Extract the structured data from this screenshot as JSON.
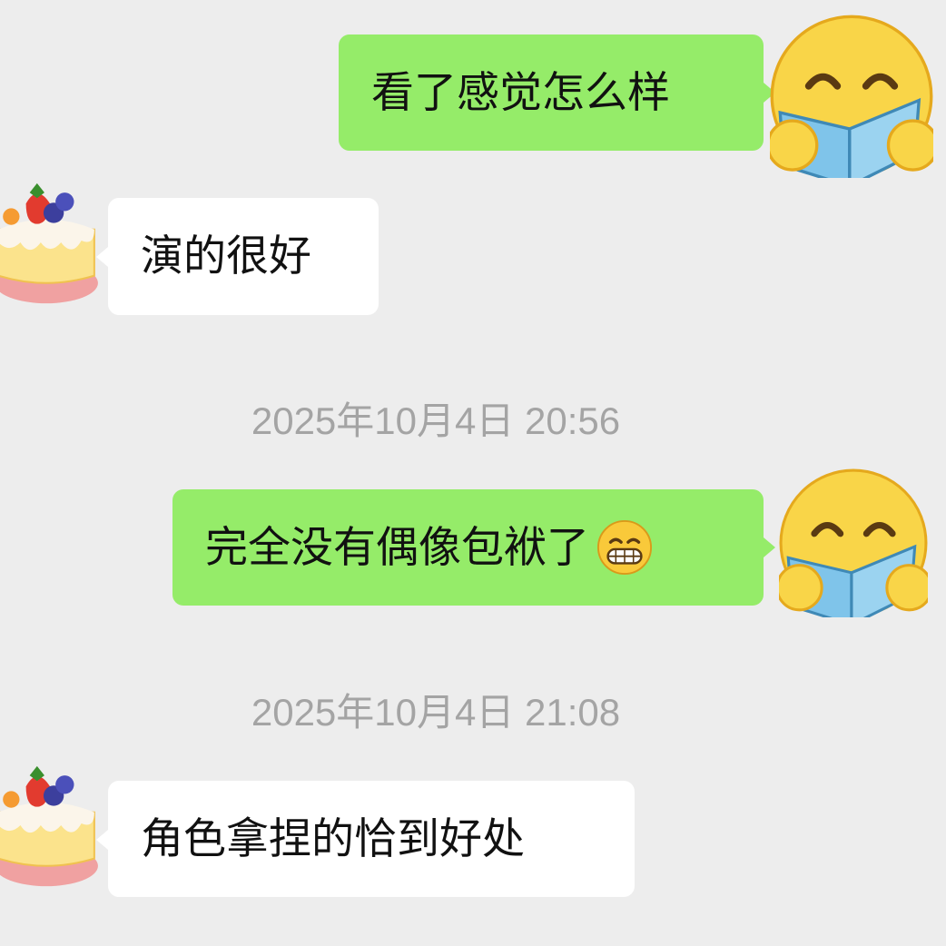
{
  "messages": [
    {
      "side": "sent",
      "text": "看了感觉怎么样"
    },
    {
      "side": "received",
      "text": "演的很好"
    },
    {
      "side": "sent",
      "text": "完全没有偶像包袱了",
      "emoji": "grinning-face-emoji"
    },
    {
      "side": "received",
      "text": "角色拿捏的恰到好处"
    }
  ],
  "timestamps": [
    "2025年10月4日 20:56",
    "2025年10月4日 21:08"
  ],
  "avatars": {
    "me": "reading-emoji-avatar",
    "contact": "cake-avatar"
  },
  "colors": {
    "background": "#ededed",
    "sent_bubble": "#95ec69",
    "received_bubble": "#ffffff",
    "timestamp_text": "#a4a4a4"
  }
}
